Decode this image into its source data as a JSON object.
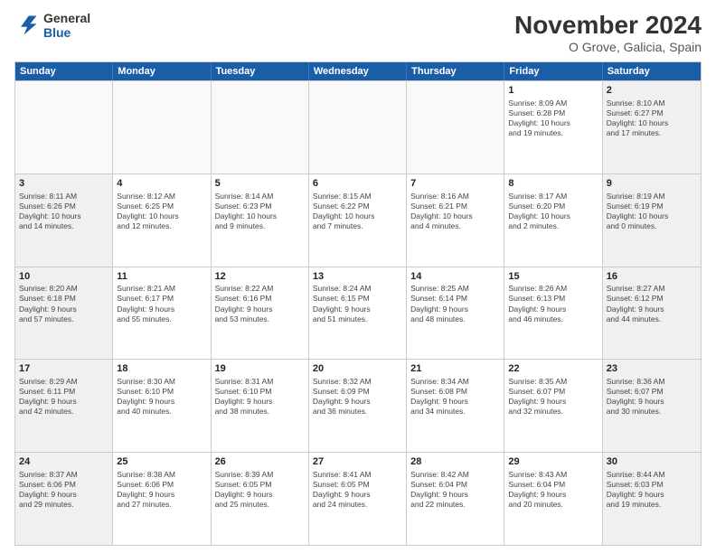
{
  "header": {
    "logo_text_general": "General",
    "logo_text_blue": "Blue",
    "month_title": "November 2024",
    "location": "O Grove, Galicia, Spain"
  },
  "weekdays": [
    "Sunday",
    "Monday",
    "Tuesday",
    "Wednesday",
    "Thursday",
    "Friday",
    "Saturday"
  ],
  "rows": [
    [
      {
        "day": "",
        "info": ""
      },
      {
        "day": "",
        "info": ""
      },
      {
        "day": "",
        "info": ""
      },
      {
        "day": "",
        "info": ""
      },
      {
        "day": "",
        "info": ""
      },
      {
        "day": "1",
        "info": "Sunrise: 8:09 AM\nSunset: 6:28 PM\nDaylight: 10 hours\nand 19 minutes."
      },
      {
        "day": "2",
        "info": "Sunrise: 8:10 AM\nSunset: 6:27 PM\nDaylight: 10 hours\nand 17 minutes."
      }
    ],
    [
      {
        "day": "3",
        "info": "Sunrise: 8:11 AM\nSunset: 6:26 PM\nDaylight: 10 hours\nand 14 minutes."
      },
      {
        "day": "4",
        "info": "Sunrise: 8:12 AM\nSunset: 6:25 PM\nDaylight: 10 hours\nand 12 minutes."
      },
      {
        "day": "5",
        "info": "Sunrise: 8:14 AM\nSunset: 6:23 PM\nDaylight: 10 hours\nand 9 minutes."
      },
      {
        "day": "6",
        "info": "Sunrise: 8:15 AM\nSunset: 6:22 PM\nDaylight: 10 hours\nand 7 minutes."
      },
      {
        "day": "7",
        "info": "Sunrise: 8:16 AM\nSunset: 6:21 PM\nDaylight: 10 hours\nand 4 minutes."
      },
      {
        "day": "8",
        "info": "Sunrise: 8:17 AM\nSunset: 6:20 PM\nDaylight: 10 hours\nand 2 minutes."
      },
      {
        "day": "9",
        "info": "Sunrise: 8:19 AM\nSunset: 6:19 PM\nDaylight: 10 hours\nand 0 minutes."
      }
    ],
    [
      {
        "day": "10",
        "info": "Sunrise: 8:20 AM\nSunset: 6:18 PM\nDaylight: 9 hours\nand 57 minutes."
      },
      {
        "day": "11",
        "info": "Sunrise: 8:21 AM\nSunset: 6:17 PM\nDaylight: 9 hours\nand 55 minutes."
      },
      {
        "day": "12",
        "info": "Sunrise: 8:22 AM\nSunset: 6:16 PM\nDaylight: 9 hours\nand 53 minutes."
      },
      {
        "day": "13",
        "info": "Sunrise: 8:24 AM\nSunset: 6:15 PM\nDaylight: 9 hours\nand 51 minutes."
      },
      {
        "day": "14",
        "info": "Sunrise: 8:25 AM\nSunset: 6:14 PM\nDaylight: 9 hours\nand 48 minutes."
      },
      {
        "day": "15",
        "info": "Sunrise: 8:26 AM\nSunset: 6:13 PM\nDaylight: 9 hours\nand 46 minutes."
      },
      {
        "day": "16",
        "info": "Sunrise: 8:27 AM\nSunset: 6:12 PM\nDaylight: 9 hours\nand 44 minutes."
      }
    ],
    [
      {
        "day": "17",
        "info": "Sunrise: 8:29 AM\nSunset: 6:11 PM\nDaylight: 9 hours\nand 42 minutes."
      },
      {
        "day": "18",
        "info": "Sunrise: 8:30 AM\nSunset: 6:10 PM\nDaylight: 9 hours\nand 40 minutes."
      },
      {
        "day": "19",
        "info": "Sunrise: 8:31 AM\nSunset: 6:10 PM\nDaylight: 9 hours\nand 38 minutes."
      },
      {
        "day": "20",
        "info": "Sunrise: 8:32 AM\nSunset: 6:09 PM\nDaylight: 9 hours\nand 36 minutes."
      },
      {
        "day": "21",
        "info": "Sunrise: 8:34 AM\nSunset: 6:08 PM\nDaylight: 9 hours\nand 34 minutes."
      },
      {
        "day": "22",
        "info": "Sunrise: 8:35 AM\nSunset: 6:07 PM\nDaylight: 9 hours\nand 32 minutes."
      },
      {
        "day": "23",
        "info": "Sunrise: 8:36 AM\nSunset: 6:07 PM\nDaylight: 9 hours\nand 30 minutes."
      }
    ],
    [
      {
        "day": "24",
        "info": "Sunrise: 8:37 AM\nSunset: 6:06 PM\nDaylight: 9 hours\nand 29 minutes."
      },
      {
        "day": "25",
        "info": "Sunrise: 8:38 AM\nSunset: 6:06 PM\nDaylight: 9 hours\nand 27 minutes."
      },
      {
        "day": "26",
        "info": "Sunrise: 8:39 AM\nSunset: 6:05 PM\nDaylight: 9 hours\nand 25 minutes."
      },
      {
        "day": "27",
        "info": "Sunrise: 8:41 AM\nSunset: 6:05 PM\nDaylight: 9 hours\nand 24 minutes."
      },
      {
        "day": "28",
        "info": "Sunrise: 8:42 AM\nSunset: 6:04 PM\nDaylight: 9 hours\nand 22 minutes."
      },
      {
        "day": "29",
        "info": "Sunrise: 8:43 AM\nSunset: 6:04 PM\nDaylight: 9 hours\nand 20 minutes."
      },
      {
        "day": "30",
        "info": "Sunrise: 8:44 AM\nSunset: 6:03 PM\nDaylight: 9 hours\nand 19 minutes."
      }
    ]
  ]
}
